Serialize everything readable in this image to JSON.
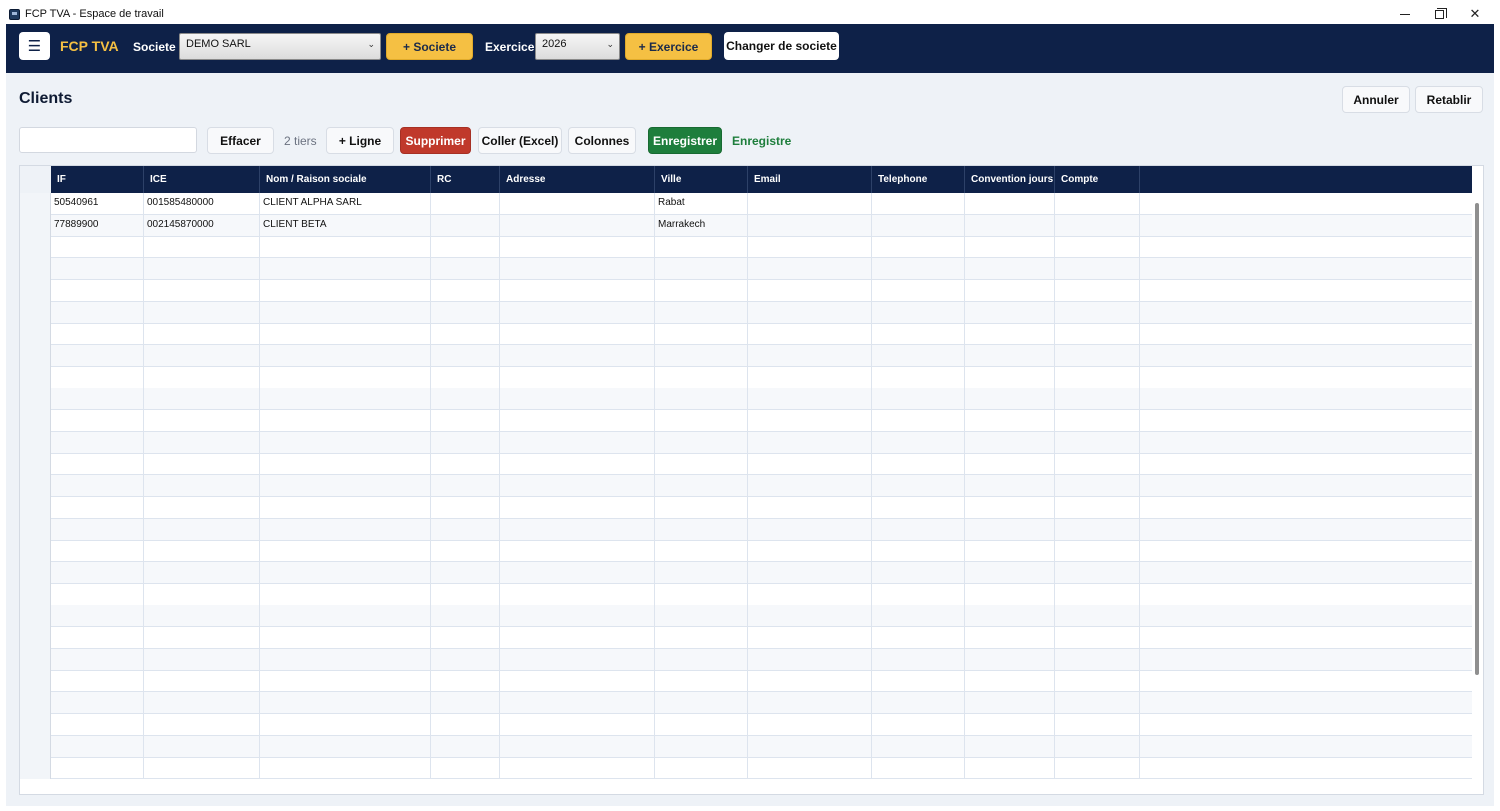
{
  "window": {
    "title": "FCP TVA - Espace de travail"
  },
  "navbar": {
    "menu_icon": "☰",
    "brand": "FCP TVA",
    "societe_label": "Societe :",
    "societe_value": "DEMO SARL",
    "add_societe": "+ Societe",
    "exercice_label": "Exercice :",
    "exercice_value": "2026",
    "add_exercice": "+ Exercice",
    "change_societe": "Changer de societe"
  },
  "page": {
    "title": "Clients",
    "undo": "Annuler",
    "redo": "Retablir"
  },
  "toolbar": {
    "search_value": "",
    "clear": "Effacer",
    "count": "2 tiers",
    "add_line": "+ Ligne",
    "delete": "Supprimer",
    "paste": "Coller (Excel)",
    "columns": "Colonnes",
    "save": "Enregistrer",
    "status": "Enregistre"
  },
  "table": {
    "headers": [
      "IF",
      "ICE",
      "Nom / Raison sociale",
      "RC",
      "Adresse",
      "Ville",
      "Email",
      "Telephone",
      "Convention jours",
      "Compte"
    ],
    "rows": [
      [
        "50540961",
        "001585480000",
        "CLIENT ALPHA SARL",
        "",
        "",
        "Rabat",
        "",
        "",
        "",
        ""
      ],
      [
        "77889900",
        "002145870000",
        "CLIENT BETA",
        "",
        "",
        "Marrakech",
        "",
        "",
        "",
        ""
      ]
    ]
  },
  "colors": {
    "navbar": "#0e2148",
    "brand": "#f5c043",
    "accent_yellow": "#f5c043",
    "danger": "#c0392b",
    "success": "#1e7e3c",
    "background": "#eef2f7"
  }
}
